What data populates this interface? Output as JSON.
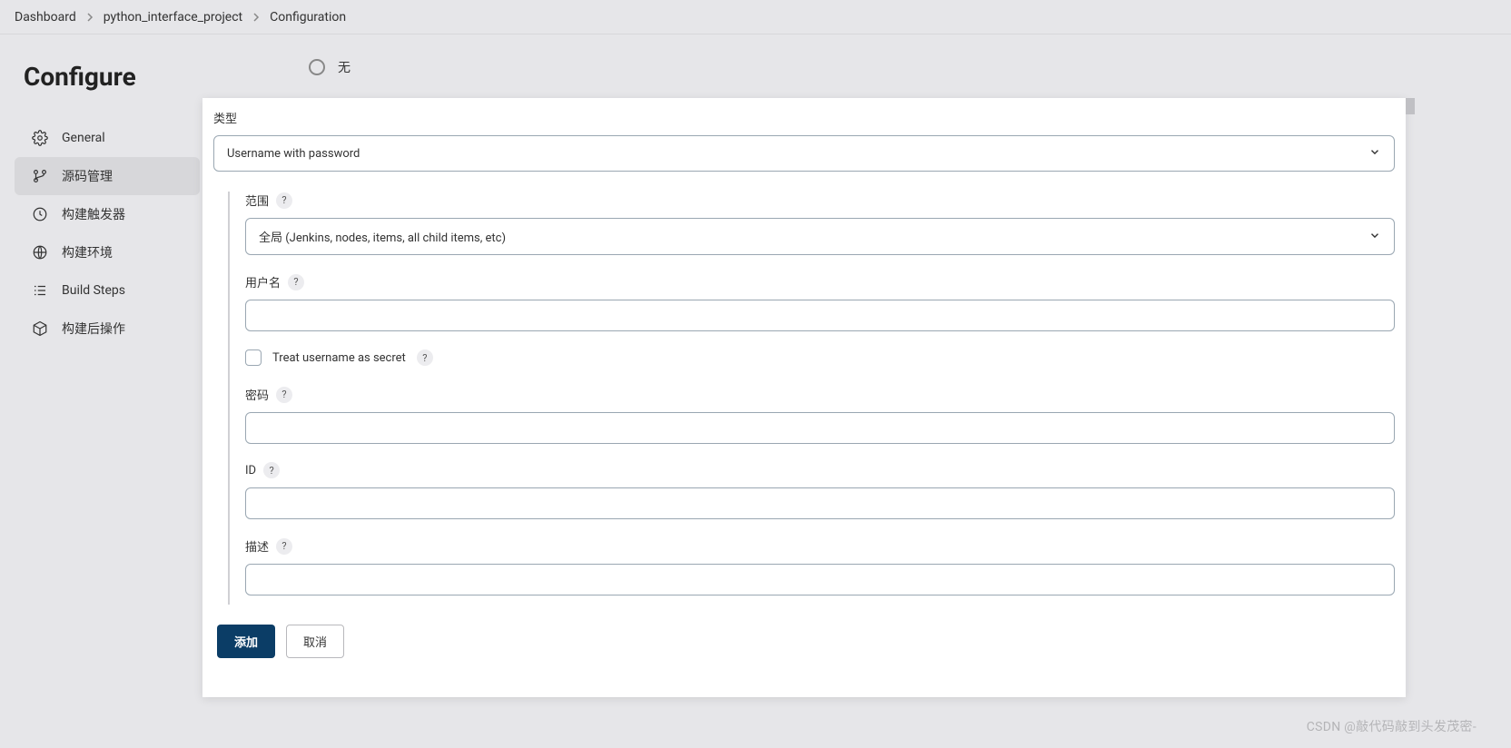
{
  "breadcrumb": {
    "items": [
      "Dashboard",
      "python_interface_project",
      "Configuration"
    ]
  },
  "page_title": "Configure",
  "sidebar": {
    "items": [
      {
        "label": "General"
      },
      {
        "label": "源码管理"
      },
      {
        "label": "构建触发器"
      },
      {
        "label": "构建环境"
      },
      {
        "label": "Build Steps"
      },
      {
        "label": "构建后操作"
      }
    ]
  },
  "top_option": {
    "none_label": "无"
  },
  "dialog": {
    "type_label": "类型",
    "type_value": "Username with password",
    "scope_label": "范围",
    "scope_value": "全局 (Jenkins, nodes, items, all child items, etc)",
    "username_label": "用户名",
    "username_value": "",
    "treat_secret_label": "Treat username as secret",
    "password_label": "密码",
    "password_value": "",
    "id_label": "ID",
    "id_value": "",
    "desc_label": "描述",
    "desc_value": "",
    "add_btn": "添加",
    "cancel_btn": "取消"
  },
  "watermark": "CSDN @敲代码敲到头发茂密-"
}
